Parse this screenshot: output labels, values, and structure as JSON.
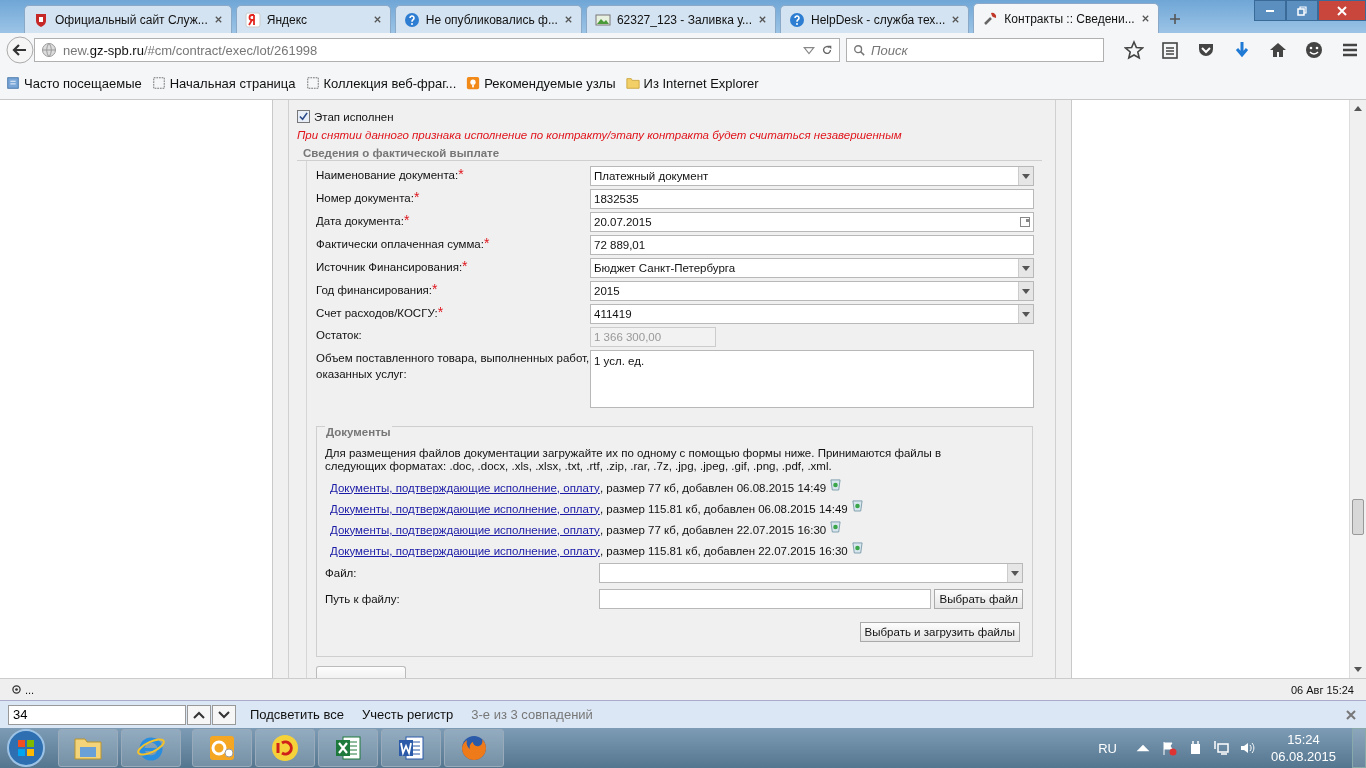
{
  "browser": {
    "tabs": [
      {
        "title": "Официальный сайт Служ...",
        "kind": "crest",
        "selected": false
      },
      {
        "title": "Яндекс",
        "kind": "yandex",
        "selected": false
      },
      {
        "title": "Не опубликовались ф...",
        "kind": "help",
        "selected": false
      },
      {
        "title": "62327_123 - Заливка у...",
        "kind": "image",
        "selected": false
      },
      {
        "title": "HelpDesk - служба тех...",
        "kind": "help",
        "selected": false
      },
      {
        "title": "Контракты :: Сведени...",
        "kind": "tools",
        "selected": true
      }
    ],
    "address": {
      "prefix": "new.",
      "domain": "gz-spb.ru",
      "path": "/#cm/contract/exec/lot/261998"
    },
    "search_placeholder": "Поиск",
    "bookmarks": [
      {
        "label": "Часто посещаемые",
        "kind": "list"
      },
      {
        "label": "Начальная страница",
        "kind": "page"
      },
      {
        "label": "Коллекция веб-фраг...",
        "kind": "page"
      },
      {
        "label": "Рекомендуемые узлы",
        "kind": "bulb"
      },
      {
        "label": "Из Internet Explorer",
        "kind": "folder"
      }
    ]
  },
  "form": {
    "stage_done": {
      "label": "Этап исполнен",
      "checked": true
    },
    "warning": "При снятии данного признака исполнение по контракту/этапу контракта будет считаться незавершенным",
    "section_title": "Сведения о фактической выплате",
    "fields": [
      {
        "label": "Наименование документа:",
        "mark": "*",
        "kind": "select",
        "value": "Платежный документ"
      },
      {
        "label": "Номер документа:",
        "mark": "*",
        "kind": "text",
        "value": "1832535"
      },
      {
        "label": "Дата документа:",
        "mark": "*",
        "kind": "date",
        "value": "20.07.2015"
      },
      {
        "label": "Фактически оплаченная сумма:",
        "mark": "*",
        "kind": "text",
        "value": "72 889,01"
      },
      {
        "label": "Источник Финансирования:",
        "mark": "*",
        "kind": "select",
        "value": "Бюджет Санкт-Петербурга"
      },
      {
        "label": "Год финансирования:",
        "mark": "*",
        "kind": "select",
        "value": "2015"
      },
      {
        "label": "Счет расходов/КОСГУ:",
        "mark": "*",
        "kind": "select",
        "value": "411419"
      },
      {
        "label": "Остаток:",
        "kind": "readonly",
        "value": "1 366 300,00"
      },
      {
        "label": "Объем поставленного товара, выполненных работ, оказанных услуг:",
        "kind": "textarea",
        "value": "1 усл. ед."
      }
    ],
    "documents": {
      "title": "Документы",
      "hint": "Для размещения файлов документации загружайте их по одному с помощью формы ниже. Принимаются файлы в следующих форматах: .doc, .docx, .xls, .xlsx, .txt, .rtf, .zip, .rar, .7z, .jpg, .jpeg, .gif, .png, .pdf, .xml.",
      "files": [
        {
          "link": "Документы, подтверждающие исполнение, оплату",
          "info": ", размер 77 кб, добавлен 06.08.2015 14:49"
        },
        {
          "link": "Документы, подтверждающие исполнение, оплату",
          "info": ", размер 115.81 кб, добавлен 06.08.2015 14:49"
        },
        {
          "link": "Документы, подтверждающие исполнение, оплату",
          "info": ", размер 77 кб, добавлен 22.07.2015 16:30"
        },
        {
          "link": "Документы, подтверждающие исполнение, оплату",
          "info": ", размер 115.81 кб, добавлен 22.07.2015 16:30"
        }
      ],
      "file_label": "Файл:",
      "path_label": "Путь к файлу:",
      "choose_button": "Выбрать файл",
      "upload_button": "Выбрать и загрузить файлы"
    }
  },
  "status_bar": {
    "left": "...",
    "right": "06 Авг 15:24"
  },
  "find_bar": {
    "value": "34",
    "highlight_all": "Подсветить все",
    "match_case": "Учесть регистр",
    "result": "3-е из 3 совпадений"
  },
  "taskbar": {
    "apps": [
      {
        "kind": "explorer"
      },
      {
        "kind": "ie"
      },
      {
        "kind": "outlook"
      },
      {
        "kind": "onec"
      },
      {
        "kind": "excel"
      },
      {
        "kind": "word"
      },
      {
        "kind": "firefox"
      }
    ],
    "language": "RU",
    "time": "15:24",
    "date": "06.08.2015"
  }
}
